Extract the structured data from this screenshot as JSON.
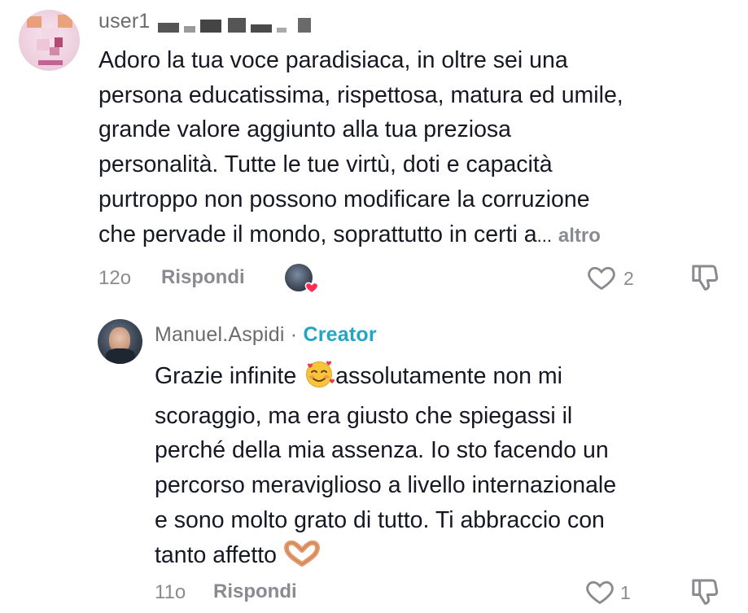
{
  "comment": {
    "username": "user1",
    "text": "Adoro la tua voce paradisiaca, in oltre sei una persona educatissima, rispettosa, matura ed umile, grande valore aggiunto alla tua preziosa personalità. Tutte le tue virtù, doti e capacità purtroppo non possono modificare la corruzione che pervade il mondo, soprattutto in certi a",
    "lines": [
      "Adoro la tua voce paradisiaca, in oltre sei una",
      "persona educatissima, rispettosa, matura ed umile,",
      "grande valore aggiunto alla tua preziosa",
      "personalità. Tutte le tue virtù, doti e capacità",
      "purtroppo non possono modificare la corruzione",
      "che pervade il mondo, soprattutto in certi a"
    ],
    "ellipsis": "...",
    "more_label": "altro",
    "time": "12o",
    "reply_label": "Rispondi",
    "likes": "2"
  },
  "reply": {
    "username": "Manuel.Aspidi",
    "separator": "·",
    "badge": "Creator",
    "lines": [
      "Grazie infinite",
      "assolutamente non mi",
      "scoraggio, ma era giusto che spiegassi il",
      "perché della mia assenza. Io sto facendo un",
      "percorso meraviglioso a livello internazionale",
      "e sono molto grato di tutto. Ti abbraccio con",
      "tanto affetto"
    ],
    "time": "11o",
    "reply_label": "Rispondi",
    "likes": "1"
  },
  "colors": {
    "text": "#161823",
    "muted": "#8a8b91",
    "creator": "#22a6c6",
    "heart_badge": "#fe2c55"
  },
  "icons": {
    "like": "heart-outline-icon",
    "dislike": "thumbs-down-icon",
    "emoji_smile": "smiling-face-with-hearts-emoji",
    "emoji_hands": "heart-hands-emoji",
    "creator_liked": "creator-liked-heart-icon"
  }
}
